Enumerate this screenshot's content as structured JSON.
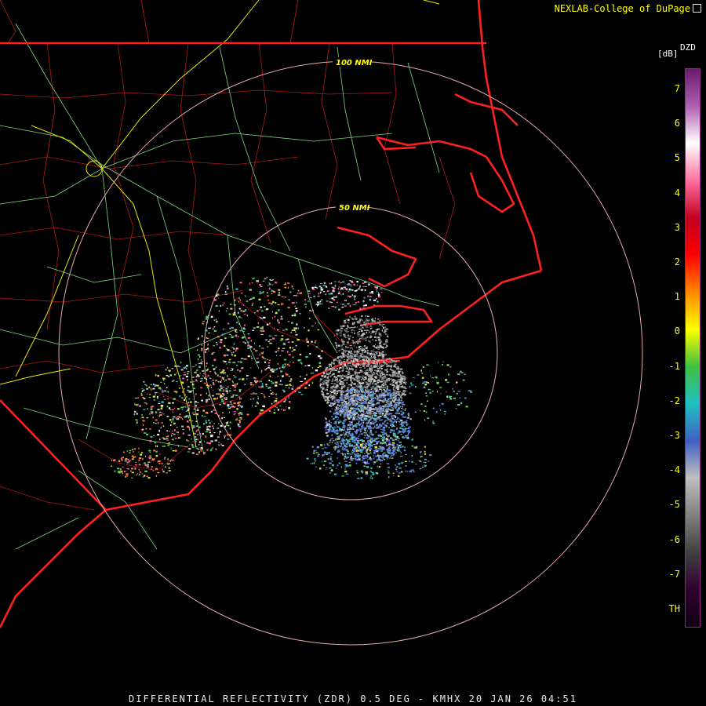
{
  "credit": "NEXLAB-College of DuPage",
  "credit_icon": "external-link-icon",
  "footer": "DIFFERENTIAL REFLECTIVITY (ZDR) 0.5 DEG - KMHX 20 JAN 26 04:51",
  "legend": {
    "product": "DZD",
    "unit": "[dB]",
    "labels": [
      "7",
      "6",
      "5",
      "4",
      "3",
      "2",
      "1",
      "0",
      "-1",
      "-2",
      "-3",
      "-4",
      "-5",
      "-6",
      "-7",
      "TH"
    ],
    "colors": [
      "#6a1a6a",
      "#b060b0",
      "#ffffff",
      "#ff70a0",
      "#c00020",
      "#ff0000",
      "#ff8800",
      "#ffff00",
      "#40c040",
      "#20c0c0",
      "#4060c0",
      "#c0c0c0",
      "#808080",
      "#404040",
      "#300030",
      "#100010"
    ]
  },
  "range_rings": [
    {
      "label": "50 NMI"
    },
    {
      "label": "100 NMI"
    }
  ],
  "colors": {
    "state_border": "#ff2020",
    "county_border": "#c01818",
    "roads": "#7fd87f",
    "highways": "#e8e800",
    "range_ring": "#e8a8a8"
  }
}
